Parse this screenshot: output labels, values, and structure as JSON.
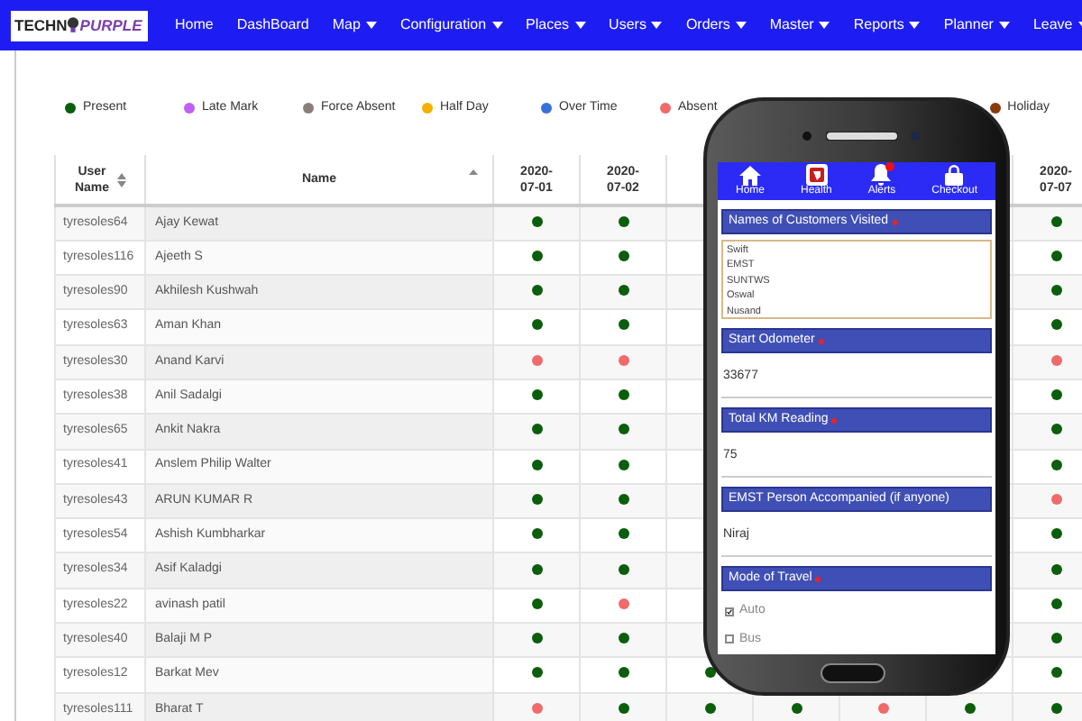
{
  "logo": {
    "left": "TECHN",
    "right": "PURPLE"
  },
  "nav": [
    {
      "label": "Home",
      "dropdown": false
    },
    {
      "label": "DashBoard",
      "dropdown": false
    },
    {
      "label": "Map",
      "dropdown": true
    },
    {
      "label": "Configuration",
      "dropdown": true
    },
    {
      "label": "Places",
      "dropdown": true
    },
    {
      "label": "Users",
      "dropdown": true
    },
    {
      "label": "Orders",
      "dropdown": true
    },
    {
      "label": "Master",
      "dropdown": true
    },
    {
      "label": "Reports",
      "dropdown": true
    },
    {
      "label": "Planner",
      "dropdown": true
    },
    {
      "label": "Leave",
      "dropdown": true
    }
  ],
  "legend": [
    {
      "label": "Present",
      "color": "#0b5e0b"
    },
    {
      "label": "Late Mark",
      "color": "#c060f0"
    },
    {
      "label": "Force Absent",
      "color": "#8a7f7a"
    },
    {
      "label": "Half Day",
      "color": "#f5b000"
    },
    {
      "label": "Over Time",
      "color": "#3a6fd8"
    },
    {
      "label": "Absent",
      "color": "#f06a6a"
    },
    {
      "label": "Holiday",
      "color": "#8b3a0e"
    }
  ],
  "table": {
    "columns": [
      {
        "lines": [
          "User",
          "Name"
        ],
        "sorted": false
      },
      {
        "lines": [
          "Name"
        ],
        "sorted": true
      }
    ],
    "date_columns": [
      {
        "lines": [
          "2020-",
          "07-01"
        ]
      },
      {
        "lines": [
          "2020-",
          "07-02"
        ]
      },
      {
        "lines": [
          "2020-",
          "07-07"
        ]
      }
    ],
    "rows": [
      {
        "user": "tyresoles64",
        "name": "Ajay Kewat",
        "days": [
          {
            "color": "#0b5e0b"
          },
          {
            "color": "#0b5e0b"
          },
          {
            "color": "#0b5e0b"
          }
        ]
      },
      {
        "user": "tyresoles116",
        "name": "Ajeeth S",
        "days": [
          {
            "color": "#0b5e0b"
          },
          {
            "color": "#0b5e0b"
          },
          {
            "color": "#0b5e0b"
          }
        ]
      },
      {
        "user": "tyresoles90",
        "name": "Akhilesh Kushwah",
        "days": [
          {
            "color": "#0b5e0b"
          },
          {
            "color": "#0b5e0b"
          },
          {
            "color": "#0b5e0b"
          }
        ]
      },
      {
        "user": "tyresoles63",
        "name": "Aman Khan",
        "days": [
          {
            "color": "#0b5e0b"
          },
          {
            "color": "#0b5e0b"
          },
          {
            "color": "#0b5e0b"
          }
        ]
      },
      {
        "user": "tyresoles30",
        "name": "Anand Karvi",
        "days": [
          {
            "color": "#f06a6a"
          },
          {
            "color": "#f06a6a"
          },
          {
            "color": "#f06a6a"
          }
        ]
      },
      {
        "user": "tyresoles38",
        "name": "Anil Sadalgi",
        "days": [
          {
            "color": "#0b5e0b"
          },
          {
            "color": "#0b5e0b"
          },
          {
            "color": "#0b5e0b"
          }
        ]
      },
      {
        "user": "tyresoles65",
        "name": "Ankit Nakra",
        "days": [
          {
            "color": "#0b5e0b"
          },
          {
            "color": "#0b5e0b"
          },
          {
            "color": "#0b5e0b"
          }
        ]
      },
      {
        "user": "tyresoles41",
        "name": "Anslem Philip Walter",
        "days": [
          {
            "color": "#0b5e0b"
          },
          {
            "color": "#0b5e0b"
          },
          {
            "color": "#0b5e0b"
          }
        ]
      },
      {
        "user": "tyresoles43",
        "name": "ARUN KUMAR R",
        "days": [
          {
            "color": "#0b5e0b"
          },
          {
            "color": "#0b5e0b"
          },
          {
            "color": "#f06a6a"
          }
        ]
      },
      {
        "user": "tyresoles54",
        "name": "Ashish Kumbharkar",
        "days": [
          {
            "color": "#0b5e0b"
          },
          {
            "color": "#0b5e0b"
          },
          {
            "color": "#0b5e0b"
          }
        ]
      },
      {
        "user": "tyresoles34",
        "name": "Asif Kaladgi",
        "days": [
          {
            "color": "#0b5e0b"
          },
          {
            "color": "#0b5e0b"
          },
          {
            "color": "#0b5e0b"
          }
        ]
      },
      {
        "user": "tyresoles22",
        "name": "avinash patil",
        "days": [
          {
            "color": "#0b5e0b"
          },
          {
            "color": "#f06a6a"
          },
          {
            "color": "#0b5e0b"
          }
        ]
      },
      {
        "user": "tyresoles40",
        "name": "Balaji M P",
        "days": [
          {
            "color": "#0b5e0b"
          },
          {
            "color": "#0b5e0b"
          },
          {
            "color": "#0b5e0b"
          }
        ]
      },
      {
        "user": "tyresoles12",
        "name": "Barkat Mev",
        "days": [
          {
            "color": "#0b5e0b"
          },
          {
            "color": "#0b5e0b"
          },
          {
            "color": "#0b5e0b"
          }
        ],
        "middle_days": [
          {
            "color": "#0b5e0b"
          }
        ]
      },
      {
        "user": "tyresoles111",
        "name": "Bharat T",
        "days": [
          {
            "color": "#f06a6a"
          },
          {
            "color": "#0b5e0b"
          },
          {
            "color": "#0b5e0b"
          }
        ],
        "middle_days": [
          {
            "color": "#0b5e0b"
          },
          {
            "color": "#0b5e0b"
          },
          {
            "color": "#f06a6a"
          },
          {
            "color": "#0b5e0b"
          }
        ]
      }
    ]
  },
  "phone": {
    "tabs": [
      {
        "label": "Home",
        "kind": "home"
      },
      {
        "label": "Health",
        "kind": "health"
      },
      {
        "label": "Alerts",
        "kind": "bell",
        "badge": true
      },
      {
        "label": "Checkout",
        "kind": "lock"
      }
    ],
    "sections": [
      {
        "title": "Names of Customers Visited",
        "required": true,
        "kind": "list",
        "lines": [
          "Swift",
          "EMST",
          "SUNTWS",
          "Oswal",
          "Nusand"
        ]
      },
      {
        "title": "Start Odometer",
        "required": true,
        "kind": "value",
        "value": "33677"
      },
      {
        "title": "Total KM Reading",
        "required": true,
        "kind": "value",
        "value": "75"
      },
      {
        "title": "EMST Person Accompanied (if anyone)",
        "required": false,
        "kind": "value",
        "value": "Niraj"
      },
      {
        "title": "Mode of Travel",
        "required": true,
        "kind": "options",
        "options": [
          {
            "label": "Auto",
            "checked": true
          },
          {
            "label": "Bus",
            "checked": false
          }
        ]
      }
    ]
  }
}
